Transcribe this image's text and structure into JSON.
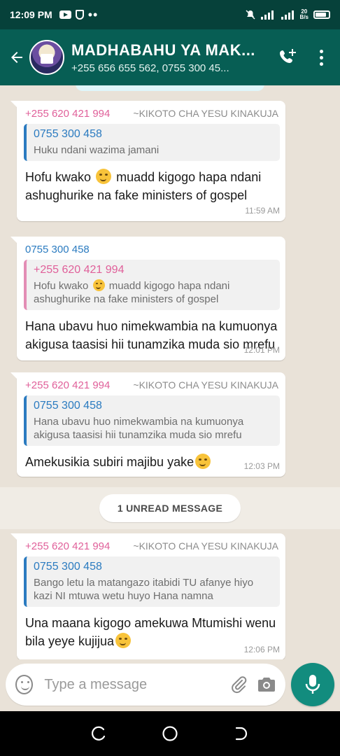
{
  "status_bar": {
    "time": "12:09 PM",
    "network_speed_top": "20",
    "network_speed_bottom": "B/s"
  },
  "header": {
    "title": "MADHABAHU YA MAK...",
    "subtitle": "+255 656 655 562, 0755 300 45..."
  },
  "messages": [
    {
      "sender": "+255 620 421 994",
      "push_name": "~KIKOTO CHA YESU KINAKUJA",
      "quote_author": "0755 300 458",
      "quote_text": "Huku ndani wazima jamani",
      "text_before": "Hofu kwako",
      "text_after": "muadd kigogo hapa ndani ashughurike na fake ministers of gospel",
      "time": "11:59 AM"
    },
    {
      "sender": "0755 300 458",
      "quote_author": "+255 620 421 994",
      "quote_text_before": "Hofu kwako",
      "quote_text_after": "muadd kigogo hapa ndani ashughurike na fake ministers of gospel",
      "text": "Hana ubavu huo nimekwambia na kumuonya akigusa taasisi hii tunamzika muda sio mrefu",
      "time": "12:01 PM"
    },
    {
      "sender": "+255 620 421 994",
      "push_name": "~KIKOTO CHA YESU KINAKUJA",
      "quote_author": "0755 300 458",
      "quote_text": "Hana ubavu huo nimekwambia na kumuonya akigusa taasisi hii tunamzika muda sio mrefu",
      "text": "Amekusikia subiri majibu yake",
      "time": "12:03 PM"
    },
    {
      "sender": "+255 620 421 994",
      "push_name": "~KIKOTO CHA YESU KINAKUJA",
      "quote_author": "0755 300 458",
      "quote_text": "Bango letu la matangazo itabidi TU afanye hiyo kazi NI mtuwa wetu huyo Hana namna",
      "text": "Una maana kigogo amekuwa Mtumishi wenu bila yeye kujijua",
      "time": "12:06 PM"
    }
  ],
  "unread_label": "1 UNREAD MESSAGE",
  "composer": {
    "placeholder": "Type a message"
  },
  "icons": {
    "back": "back-arrow-icon",
    "call": "add-call-icon",
    "menu": "more-vert-icon",
    "emoji": "emoji-icon",
    "attach": "paperclip-icon",
    "camera": "camera-icon",
    "mic": "mic-icon",
    "nav_recents": "recents-icon",
    "nav_home": "home-icon",
    "nav_back": "nav-back-icon"
  },
  "colors": {
    "header": "#075e54",
    "status_bar": "#06413a",
    "accent": "#128c7e",
    "pink_sender": "#e0609a",
    "blue_sender": "#2b7bc0"
  }
}
